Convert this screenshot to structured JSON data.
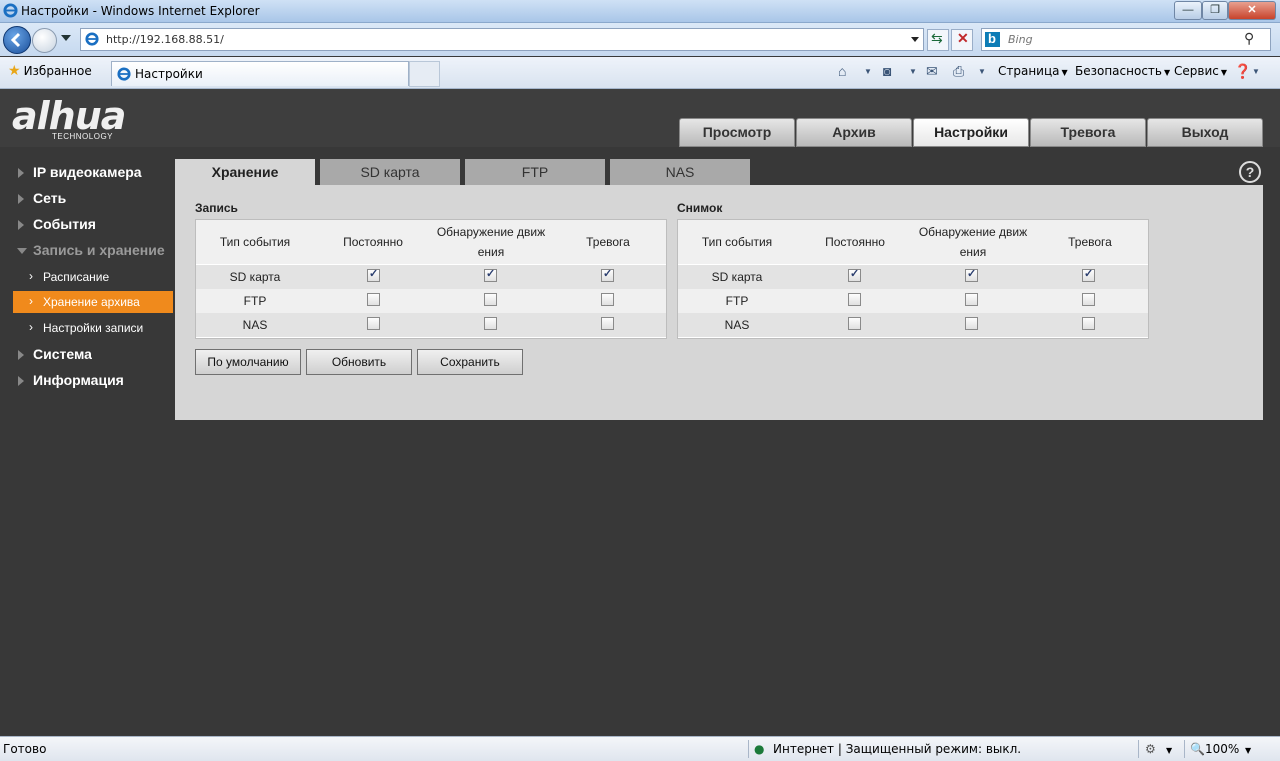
{
  "window": {
    "title": "Настройки - Windows Internet Explorer",
    "min_glyph": "—",
    "max_glyph": "❐",
    "close_glyph": "✕"
  },
  "browser": {
    "url": "http://192.168.88.51/",
    "search_placeholder": "Bing",
    "favorites_label": "Избранное",
    "tab_label": "Настройки",
    "commands": {
      "page": "Страница",
      "safety": "Безопасность",
      "tools": "Сервис"
    },
    "icons": [
      "home-icon",
      "rss-icon",
      "mail-icon",
      "print-icon",
      "help-icon"
    ]
  },
  "app": {
    "logo_text": "alhua",
    "logo_sub": "TECHNOLOGY",
    "top_nav": [
      {
        "label": "Просмотр",
        "active": false
      },
      {
        "label": "Архив",
        "active": false
      },
      {
        "label": "Настройки",
        "active": true
      },
      {
        "label": "Тревога",
        "active": false
      },
      {
        "label": "Выход",
        "active": false
      }
    ],
    "sidebar": {
      "items": [
        {
          "label": "IP видеокамера"
        },
        {
          "label": "Сеть"
        },
        {
          "label": "События"
        },
        {
          "label": "Запись и хранение"
        },
        {
          "label": "Система"
        },
        {
          "label": "Информация"
        }
      ],
      "subitems": [
        {
          "label": "Расписание",
          "active": false
        },
        {
          "label": "Хранение архива",
          "active": true
        },
        {
          "label": "Настройки записи",
          "active": false
        }
      ]
    },
    "content_tabs": [
      {
        "label": "Хранение",
        "active": true
      },
      {
        "label": "SD карта",
        "active": false
      },
      {
        "label": "FTP",
        "active": false
      },
      {
        "label": "NAS",
        "active": false
      }
    ],
    "help_glyph": "?",
    "record": {
      "title": "Запись",
      "headers": [
        "Тип события",
        "Постоянно",
        "Обнаружение движ ения",
        "Тревога"
      ],
      "rows": [
        {
          "type": "SD карта",
          "continuous": true,
          "motion": true,
          "alarm": true
        },
        {
          "type": "FTP",
          "continuous": false,
          "motion": false,
          "alarm": false
        },
        {
          "type": "NAS",
          "continuous": false,
          "motion": false,
          "alarm": false
        }
      ]
    },
    "snapshot": {
      "title": "Снимок",
      "headers": [
        "Тип события",
        "Постоянно",
        "Обнаружение движ ения",
        "Тревога"
      ],
      "rows": [
        {
          "type": "SD карта",
          "continuous": true,
          "motion": true,
          "alarm": true
        },
        {
          "type": "FTP",
          "continuous": false,
          "motion": false,
          "alarm": false
        },
        {
          "type": "NAS",
          "continuous": false,
          "motion": false,
          "alarm": false
        }
      ]
    },
    "buttons": {
      "default": "По умолчанию",
      "refresh": "Обновить",
      "save": "Сохранить"
    }
  },
  "status": {
    "left": "Готово",
    "zone": "Интернет | Защищенный режим: выкл.",
    "zoom": "100%"
  }
}
